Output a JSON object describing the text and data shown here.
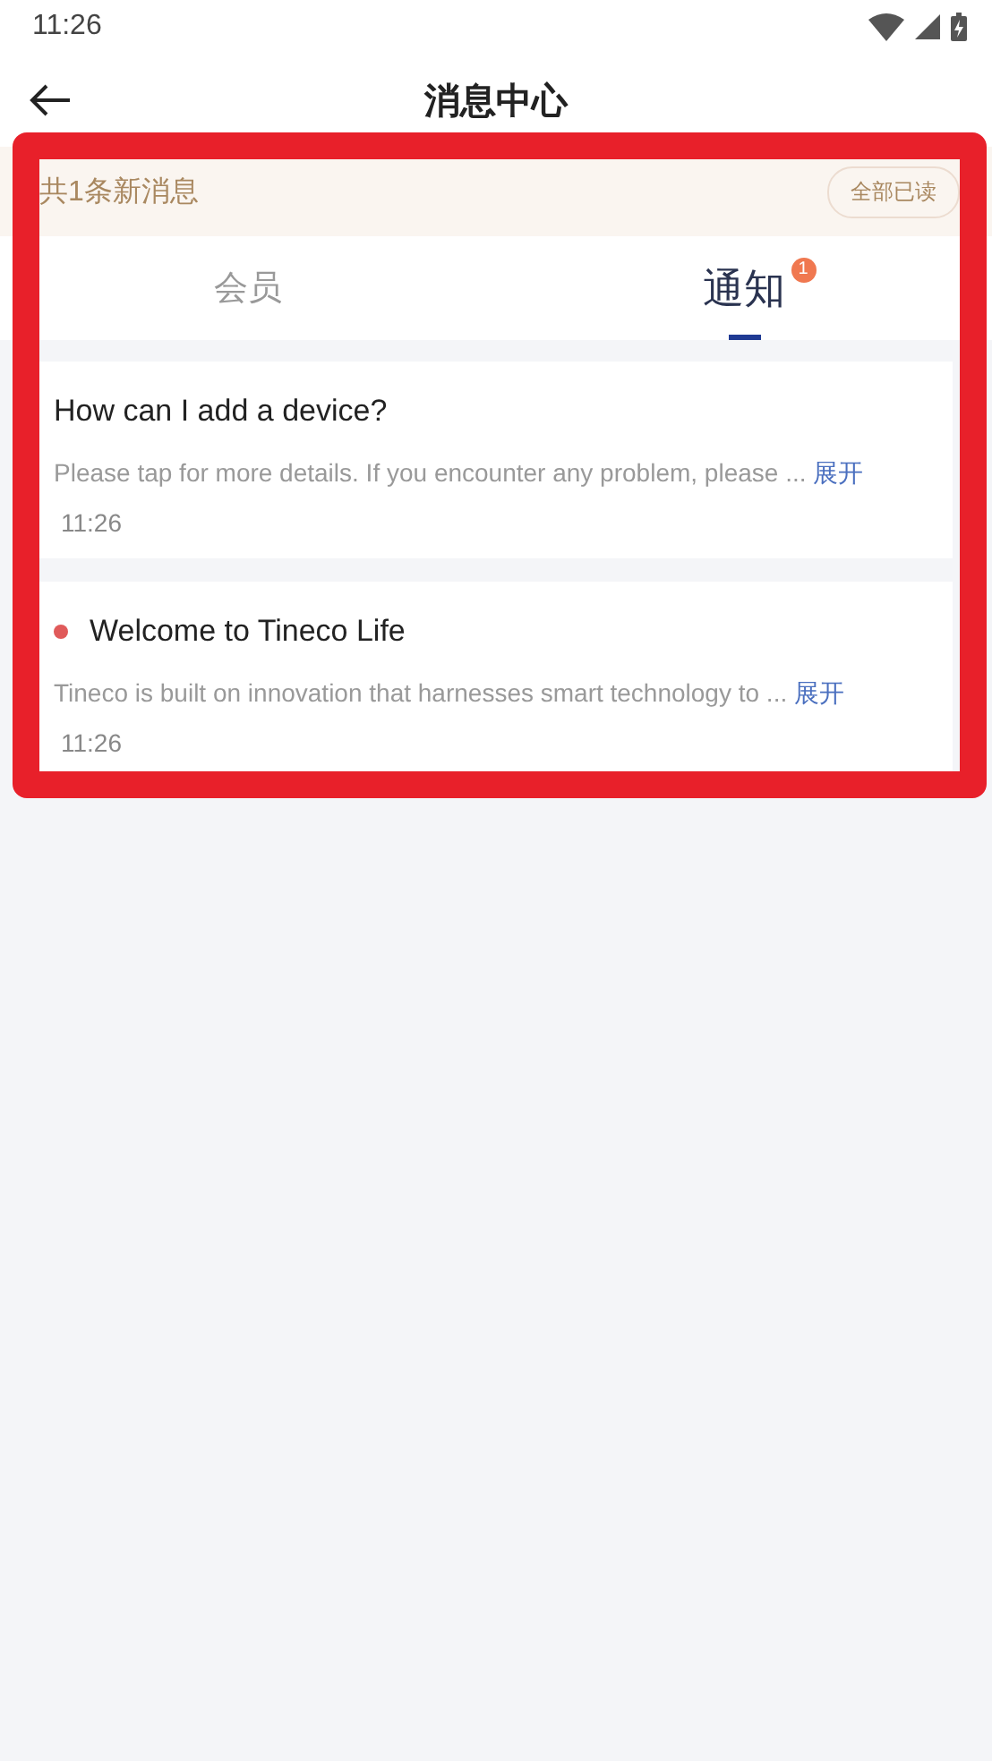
{
  "status_bar": {
    "time": "11:26"
  },
  "header": {
    "title": "消息中心"
  },
  "banner": {
    "text": "共1条新消息",
    "button": "全部已读"
  },
  "tabs": [
    {
      "label": "会员",
      "selected": false
    },
    {
      "label": "通知",
      "selected": true,
      "badge": "1"
    }
  ],
  "messages": [
    {
      "title": "How can I add a device?",
      "unread": false,
      "body": "Please tap for more details. If you encounter any problem, please ...",
      "expand": "展开",
      "time": "11:26"
    },
    {
      "title": "Welcome to Tineco Life",
      "unread": true,
      "body": "Tineco is built on innovation that harnesses smart technology to ...",
      "expand": "展开",
      "time": "11:26"
    }
  ],
  "highlight": {
    "kind": "frame"
  }
}
